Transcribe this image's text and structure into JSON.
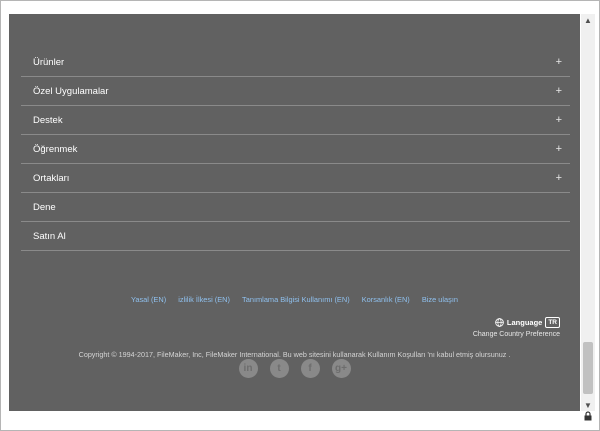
{
  "menu": [
    {
      "label": "Ürünler",
      "expand": "+"
    },
    {
      "label": "Özel Uygulamalar",
      "expand": "+"
    },
    {
      "label": "Destek",
      "expand": "+"
    },
    {
      "label": "Öğrenmek",
      "expand": "+"
    },
    {
      "label": "Ortakları",
      "expand": "+"
    },
    {
      "label": "Dene",
      "expand": ""
    },
    {
      "label": "Satın Al",
      "expand": ""
    }
  ],
  "footer_links": [
    "Yasal (EN)",
    "izlilik İlkesi (EN)",
    "Tanımlama Bilgisi Kullanımı (EN)",
    "Korsanlık (EN)",
    "Bize ulaşın"
  ],
  "language": {
    "label": "Language",
    "badge": "TR",
    "sub": "Change Country Preference"
  },
  "copyright": "Copyright © 1994-2017, FileMaker, Inc, FileMaker International. Bu web sitesini kullanarak Kullanım Koşulları 'nı kabul etmiş olursunuz .",
  "social": [
    "linkedin",
    "twitter",
    "facebook",
    "google-plus"
  ],
  "social_glyphs": [
    "in",
    "t",
    "f",
    "g+"
  ],
  "scroll": {
    "up": "▲",
    "down": "▼"
  },
  "colors": {
    "background": "#616161",
    "links": "#8fc0ee",
    "text": "#ffffff"
  }
}
